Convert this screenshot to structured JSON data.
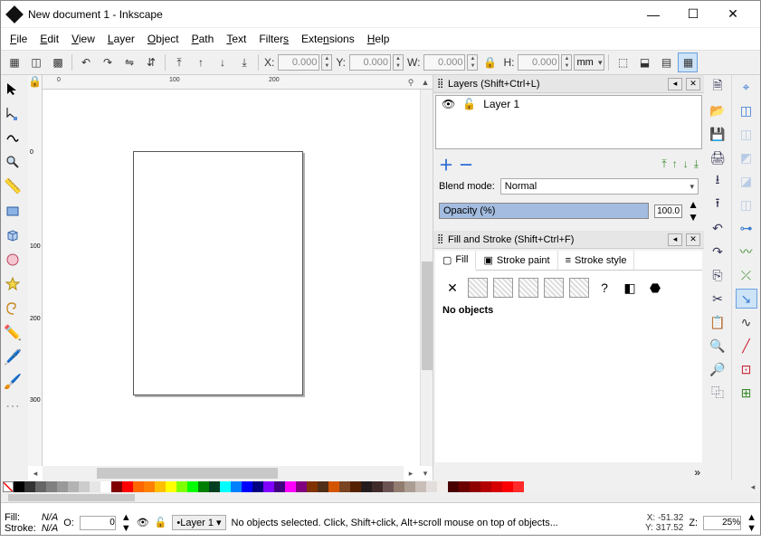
{
  "title": "New document 1 - Inkscape",
  "menu": [
    "File",
    "Edit",
    "View",
    "Layer",
    "Object",
    "Path",
    "Text",
    "Filters",
    "Extensions",
    "Help"
  ],
  "tooloptions": {
    "x_label": "X:",
    "x_val": "0.000",
    "y_label": "Y:",
    "y_val": "0.000",
    "w_label": "W:",
    "w_val": "0.000",
    "h_label": "H:",
    "h_val": "0.000",
    "unit": "mm"
  },
  "ruler_ticks_h": [
    "0",
    "100",
    "200"
  ],
  "ruler_ticks_v": [
    "0",
    "100",
    "200",
    "300"
  ],
  "layers_panel": {
    "title": "Layers (Shift+Ctrl+L)",
    "layer_name": "Layer 1",
    "blend_label": "Blend mode:",
    "blend_value": "Normal",
    "opacity_label": "Opacity (%)",
    "opacity_value": "100.0"
  },
  "fillstroke_panel": {
    "title": "Fill and Stroke (Shift+Ctrl+F)",
    "tabs": [
      "Fill",
      "Stroke paint",
      "Stroke style"
    ],
    "noobj": "No objects"
  },
  "palette": [
    "#000000",
    "#333333",
    "#666666",
    "#808080",
    "#999999",
    "#b3b3b3",
    "#cccccc",
    "#e6e6e6",
    "#ffffff",
    "#800000",
    "#ff0000",
    "#ff6600",
    "#ff8000",
    "#ffbf00",
    "#ffff00",
    "#80ff00",
    "#00ff00",
    "#008000",
    "#004020",
    "#00ffff",
    "#0080ff",
    "#0000ff",
    "#000080",
    "#8000ff",
    "#400080",
    "#ff00ff",
    "#800080",
    "#803300",
    "#502d16",
    "#d45500",
    "#784421",
    "#552200",
    "#241c1c",
    "#3f2a2a",
    "#6c5353",
    "#917c6f",
    "#ac9d93",
    "#c8beb7",
    "#e3dedb",
    "#f2eeeb",
    "#490000",
    "#6c0000",
    "#8f0000",
    "#b30000",
    "#d60000",
    "#fa0000",
    "#ff2a2a"
  ],
  "status": {
    "fill_label": "Fill:",
    "fill_value": "N/A",
    "stroke_label": "Stroke:",
    "stroke_value": "N/A",
    "o_label": "O:",
    "o_value": "0",
    "layer_value": "Layer 1",
    "message": "No objects selected. Click, Shift+click, Alt+scroll mouse on top of objects...",
    "x_label": "X:",
    "x_value": "-51.32",
    "y_label": "Y:",
    "y_value": "317.52",
    "z_label": "Z:",
    "z_value": "25%"
  }
}
